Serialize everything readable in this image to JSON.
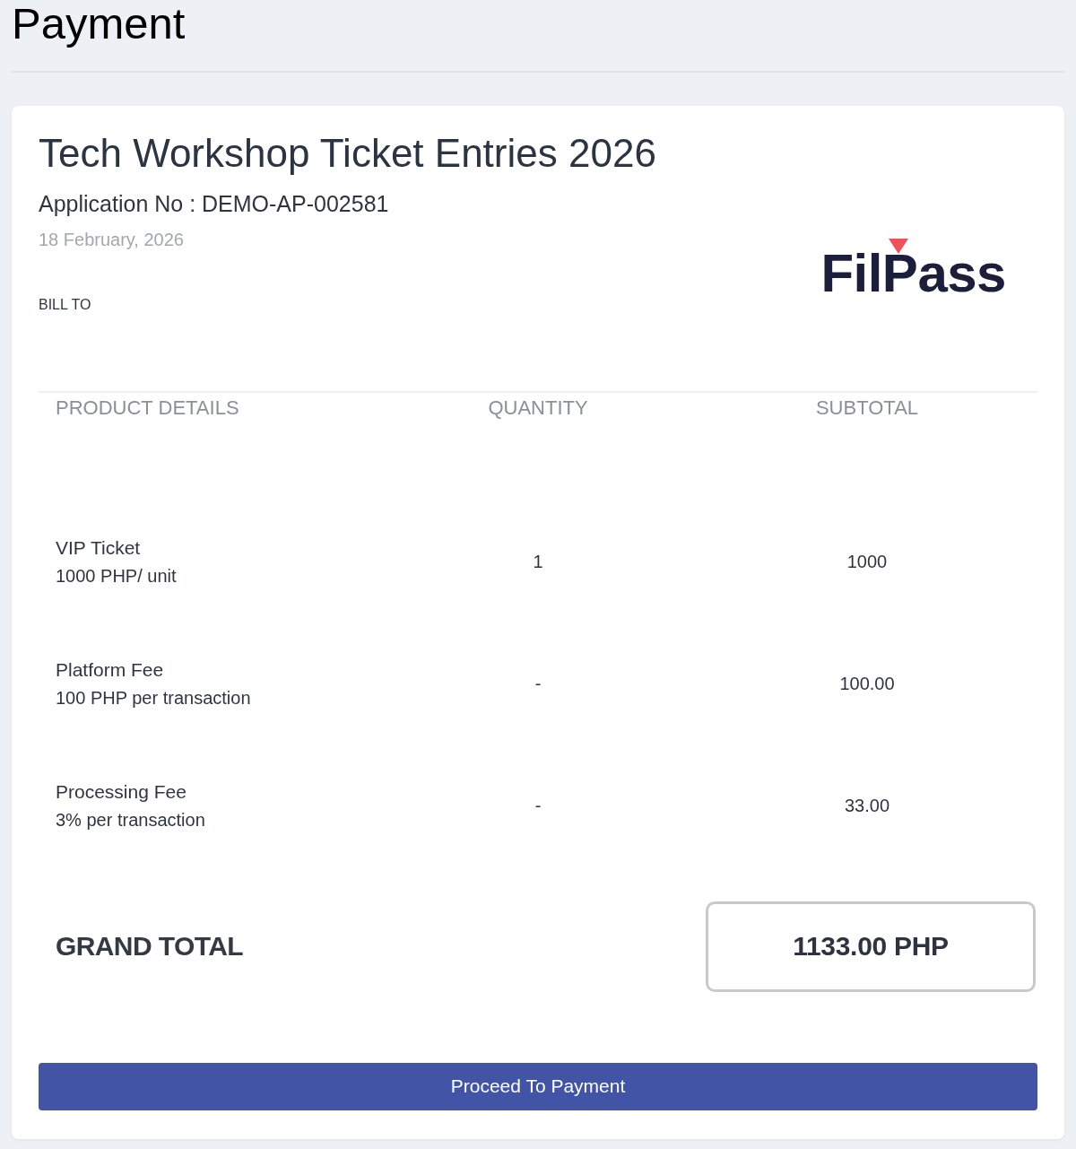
{
  "page": {
    "title": "Payment"
  },
  "invoice": {
    "event_title": "Tech Workshop Ticket Entries 2026",
    "application_number": "Application No : DEMO-AP-002581",
    "date": "18 February, 2026",
    "bill_to_label": "BILL TO"
  },
  "logo": {
    "text": "FilPass"
  },
  "table": {
    "columns": [
      "PRODUCT DETAILS",
      "QUANTITY",
      "SUBTOTAL"
    ],
    "rows": [
      {
        "name": "VIP Ticket",
        "detail": "1000 PHP/ unit",
        "quantity": "1",
        "subtotal": "1000"
      },
      {
        "name": "Platform Fee",
        "detail": "100 PHP per transaction",
        "quantity": "-",
        "subtotal": "100.00"
      },
      {
        "name": "Processing Fee",
        "detail": "3% per transaction",
        "quantity": "-",
        "subtotal": "33.00"
      }
    ]
  },
  "grand_total": {
    "label": "GRAND TOTAL",
    "value": "1133.00 PHP"
  },
  "button": {
    "label": "Proceed To Payment"
  }
}
